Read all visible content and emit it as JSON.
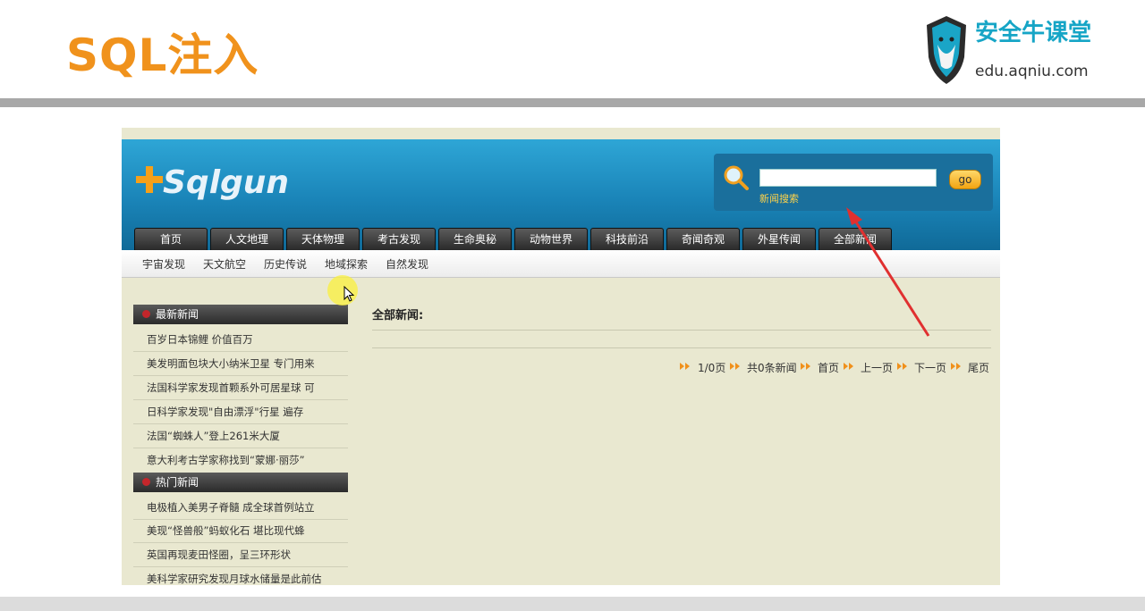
{
  "slide": {
    "title": "SQL注入",
    "brand_name": "安全牛课堂",
    "brand_url": "edu.aqniu.com"
  },
  "site": {
    "logo_text": "Sqlgun",
    "search": {
      "placeholder": "",
      "button_label": "go",
      "label": "新闻搜索"
    },
    "nav": [
      "首页",
      "人文地理",
      "天体物理",
      "考古发现",
      "生命奥秘",
      "动物世界",
      "科技前沿",
      "奇闻奇观",
      "外星传闻",
      "全部新闻"
    ],
    "subnav": [
      "宇宙发现",
      "天文航空",
      "历史传说",
      "地域探索",
      "自然发现"
    ],
    "latest_news": {
      "title": "最新新闻",
      "items": [
        "百岁日本锦鲤 价值百万",
        "美发明面包块大小纳米卫星 专门用来",
        "法国科学家发现首颗系外可居星球 可",
        "日科学家发现\"自由漂浮\"行星 遍存",
        "法国“蜘蛛人”登上261米大厦",
        "意大利考古学家称找到“蒙娜·丽莎”"
      ]
    },
    "hot_news": {
      "title": "热门新闻",
      "items": [
        "电极植入美男子脊髓 成全球首例站立",
        "美现“怪兽般”蚂蚁化石 堪比现代蜂",
        "英国再现麦田怪圈，呈三环形状",
        "美科学家研究发现月球水储量是此前估"
      ]
    },
    "main": {
      "title": "全部新闻:"
    },
    "pager": {
      "page_info": "1/0页",
      "total": "共0条新闻",
      "first": "首页",
      "prev": "上一页",
      "next": "下一页",
      "last": "尾页"
    }
  },
  "colors": {
    "title_orange": "#f0921c",
    "header_blue": "#1a84b8",
    "page_bg": "#e9e8d0",
    "annotation_red": "#e03030"
  }
}
